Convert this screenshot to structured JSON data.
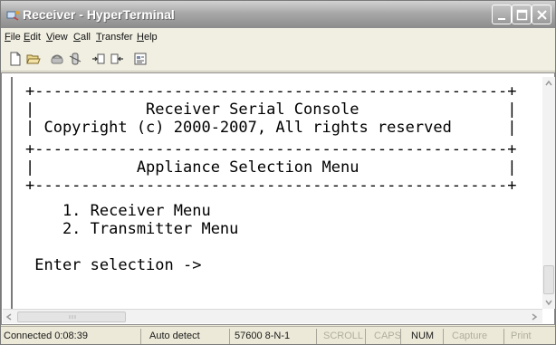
{
  "window": {
    "title": "Receiver - HyperTerminal"
  },
  "titlebar": {
    "icons": [
      "hyperterminal-app-icon",
      "minimize-icon",
      "maximize-icon",
      "close-icon"
    ]
  },
  "menu": {
    "file": "File",
    "edit": "Edit",
    "view": "View",
    "call": "Call",
    "transfer": "Transfer",
    "help": "Help"
  },
  "toolbar": {
    "icons": [
      "new-document-icon",
      "open-folder-icon",
      "connect-phone-icon",
      "disconnect-phone-icon",
      "send-file-icon",
      "receive-file-icon",
      "properties-icon"
    ]
  },
  "terminal": {
    "border_top": "+---------------------------------------------------+",
    "title": "|            Receiver Serial Console                |",
    "copyright": "| Copyright (c) 2000-2007, All rights reserved      |",
    "border_mid": "+---------------------------------------------------+",
    "menu_title": "|           Appliance Selection Menu                |",
    "border_bottom": "+---------------------------------------------------+",
    "option_1": "    1. Receiver Menu",
    "option_2": "    2. Transmitter Menu",
    "prompt": " Enter selection ->"
  },
  "statusbar": {
    "connected": "Connected 0:08:39",
    "detect": "Auto detect",
    "port_settings": "57600 8-N-1",
    "scroll": "SCROLL",
    "caps": "CAPS",
    "num": "NUM",
    "capture": "Capture",
    "print": "Print"
  },
  "colors": {
    "titlebar": "#9a9a9a",
    "terminal_background": "#ffffff",
    "terminal_text": "#000000",
    "inactive_status_text": "#b0ae9f"
  }
}
